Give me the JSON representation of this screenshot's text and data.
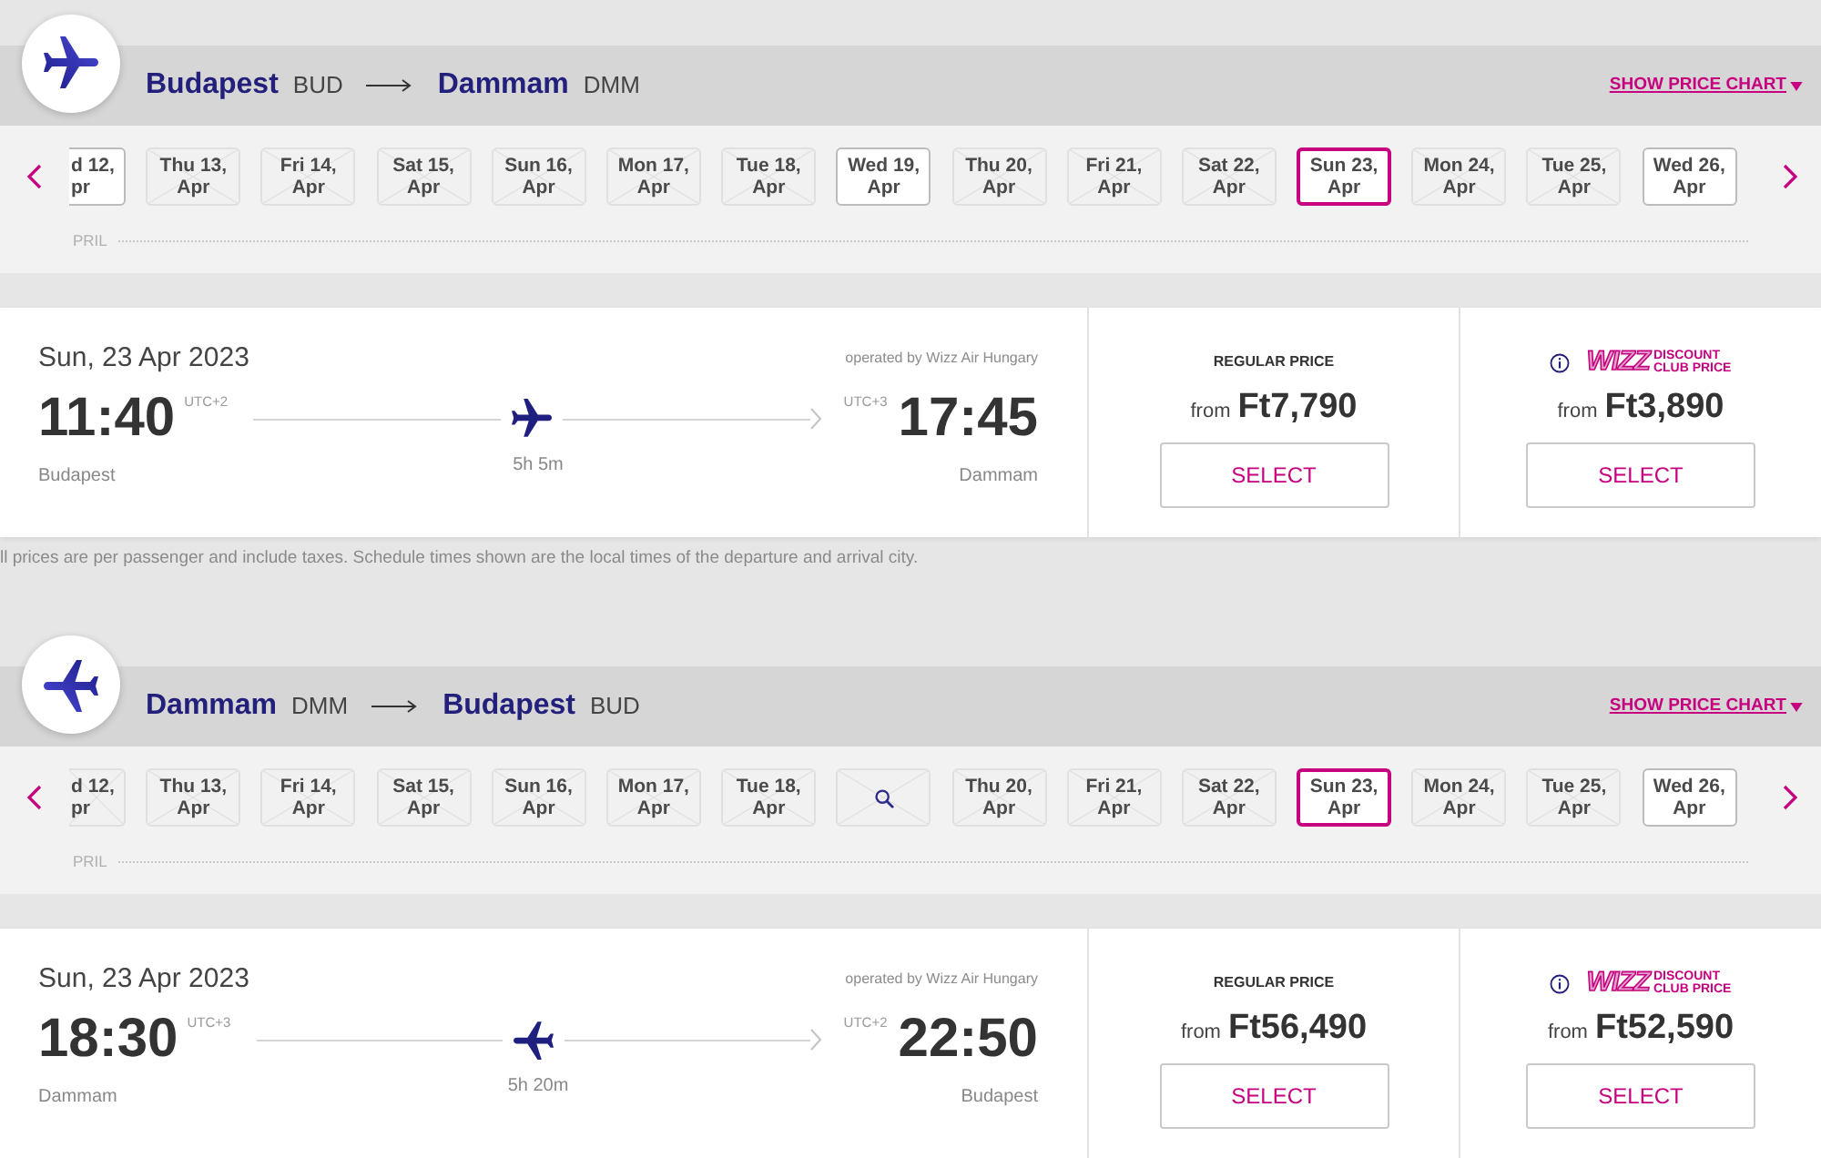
{
  "legs": [
    {
      "kind": "outbound",
      "origin": {
        "city": "Budapest",
        "code": "BUD"
      },
      "destination": {
        "city": "Dammam",
        "code": "DMM"
      },
      "price_chart_link": "SHOW PRICE CHART",
      "dates": [
        {
          "kind": "cut",
          "day": "d 12,",
          "month": "pr",
          "available": true,
          "selected": false
        },
        {
          "kind": "date",
          "day": "Thu 13,",
          "month": "Apr",
          "available": false,
          "selected": false
        },
        {
          "kind": "date",
          "day": "Fri 14,",
          "month": "Apr",
          "available": false,
          "selected": false
        },
        {
          "kind": "date",
          "day": "Sat 15,",
          "month": "Apr",
          "available": false,
          "selected": false
        },
        {
          "kind": "date",
          "day": "Sun 16,",
          "month": "Apr",
          "available": false,
          "selected": false
        },
        {
          "kind": "date",
          "day": "Mon 17,",
          "month": "Apr",
          "available": false,
          "selected": false
        },
        {
          "kind": "date",
          "day": "Tue 18,",
          "month": "Apr",
          "available": false,
          "selected": false
        },
        {
          "kind": "date",
          "day": "Wed 19,",
          "month": "Apr",
          "available": true,
          "selected": false
        },
        {
          "kind": "date",
          "day": "Thu 20,",
          "month": "Apr",
          "available": false,
          "selected": false
        },
        {
          "kind": "date",
          "day": "Fri 21,",
          "month": "Apr",
          "available": false,
          "selected": false
        },
        {
          "kind": "date",
          "day": "Sat 22,",
          "month": "Apr",
          "available": false,
          "selected": false
        },
        {
          "kind": "date",
          "day": "Sun 23,",
          "month": "Apr",
          "available": true,
          "selected": true
        },
        {
          "kind": "date",
          "day": "Mon 24,",
          "month": "Apr",
          "available": false,
          "selected": false
        },
        {
          "kind": "date",
          "day": "Tue 25,",
          "month": "Apr",
          "available": false,
          "selected": false
        },
        {
          "kind": "date",
          "day": "Wed 26,",
          "month": "Apr",
          "available": true,
          "selected": false
        }
      ],
      "month_label": "PRIL",
      "flight": {
        "date": "Sun, 23 Apr 2023",
        "operator": "operated by Wizz Air Hungary",
        "departure": {
          "time": "11:40",
          "utc": "UTC+2",
          "city": "Budapest"
        },
        "arrival": {
          "time": "17:45",
          "utc": "UTC+3",
          "city": "Dammam"
        },
        "duration": "5h 5m",
        "fares": [
          {
            "kind": "regular",
            "label": "REGULAR PRICE",
            "from": "from",
            "price": "Ft7,790",
            "button": "SELECT"
          },
          {
            "kind": "club",
            "brand": "WIZZ",
            "label_lines": [
              "DISCOUNT",
              "CLUB PRICE"
            ],
            "from": "from",
            "price": "Ft3,890",
            "button": "SELECT"
          }
        ]
      },
      "note": "ll prices are per passenger and include taxes. Schedule times shown are the local times of the departure and arrival city."
    },
    {
      "kind": "return",
      "origin": {
        "city": "Dammam",
        "code": "DMM"
      },
      "destination": {
        "city": "Budapest",
        "code": "BUD"
      },
      "price_chart_link": "SHOW PRICE CHART",
      "dates": [
        {
          "kind": "cut",
          "day": "d 12,",
          "month": "pr",
          "available": false,
          "selected": false
        },
        {
          "kind": "date",
          "day": "Thu 13,",
          "month": "Apr",
          "available": false,
          "selected": false
        },
        {
          "kind": "date",
          "day": "Fri 14,",
          "month": "Apr",
          "available": false,
          "selected": false
        },
        {
          "kind": "date",
          "day": "Sat 15,",
          "month": "Apr",
          "available": false,
          "selected": false
        },
        {
          "kind": "date",
          "day": "Sun 16,",
          "month": "Apr",
          "available": false,
          "selected": false
        },
        {
          "kind": "date",
          "day": "Mon 17,",
          "month": "Apr",
          "available": false,
          "selected": false
        },
        {
          "kind": "date",
          "day": "Tue 18,",
          "month": "Apr",
          "available": false,
          "selected": false
        },
        {
          "kind": "search",
          "available": false,
          "selected": false
        },
        {
          "kind": "date",
          "day": "Thu 20,",
          "month": "Apr",
          "available": false,
          "selected": false
        },
        {
          "kind": "date",
          "day": "Fri 21,",
          "month": "Apr",
          "available": false,
          "selected": false
        },
        {
          "kind": "date",
          "day": "Sat 22,",
          "month": "Apr",
          "available": false,
          "selected": false
        },
        {
          "kind": "date",
          "day": "Sun 23,",
          "month": "Apr",
          "available": true,
          "selected": true
        },
        {
          "kind": "date",
          "day": "Mon 24,",
          "month": "Apr",
          "available": false,
          "selected": false
        },
        {
          "kind": "date",
          "day": "Tue 25,",
          "month": "Apr",
          "available": false,
          "selected": false
        },
        {
          "kind": "date",
          "day": "Wed 26,",
          "month": "Apr",
          "available": true,
          "selected": false
        }
      ],
      "month_label": "PRIL",
      "flight": {
        "date": "Sun, 23 Apr 2023",
        "operator": "operated by Wizz Air Hungary",
        "departure": {
          "time": "18:30",
          "utc": "UTC+3",
          "city": "Dammam"
        },
        "arrival": {
          "time": "22:50",
          "utc": "UTC+2",
          "city": "Budapest"
        },
        "duration": "5h 20m",
        "fares": [
          {
            "kind": "regular",
            "label": "REGULAR PRICE",
            "from": "from",
            "price": "Ft56,490",
            "button": "SELECT"
          },
          {
            "kind": "club",
            "brand": "WIZZ",
            "label_lines": [
              "DISCOUNT",
              "CLUB PRICE"
            ],
            "from": "from",
            "price": "Ft52,590",
            "button": "SELECT"
          }
        ]
      }
    }
  ]
}
